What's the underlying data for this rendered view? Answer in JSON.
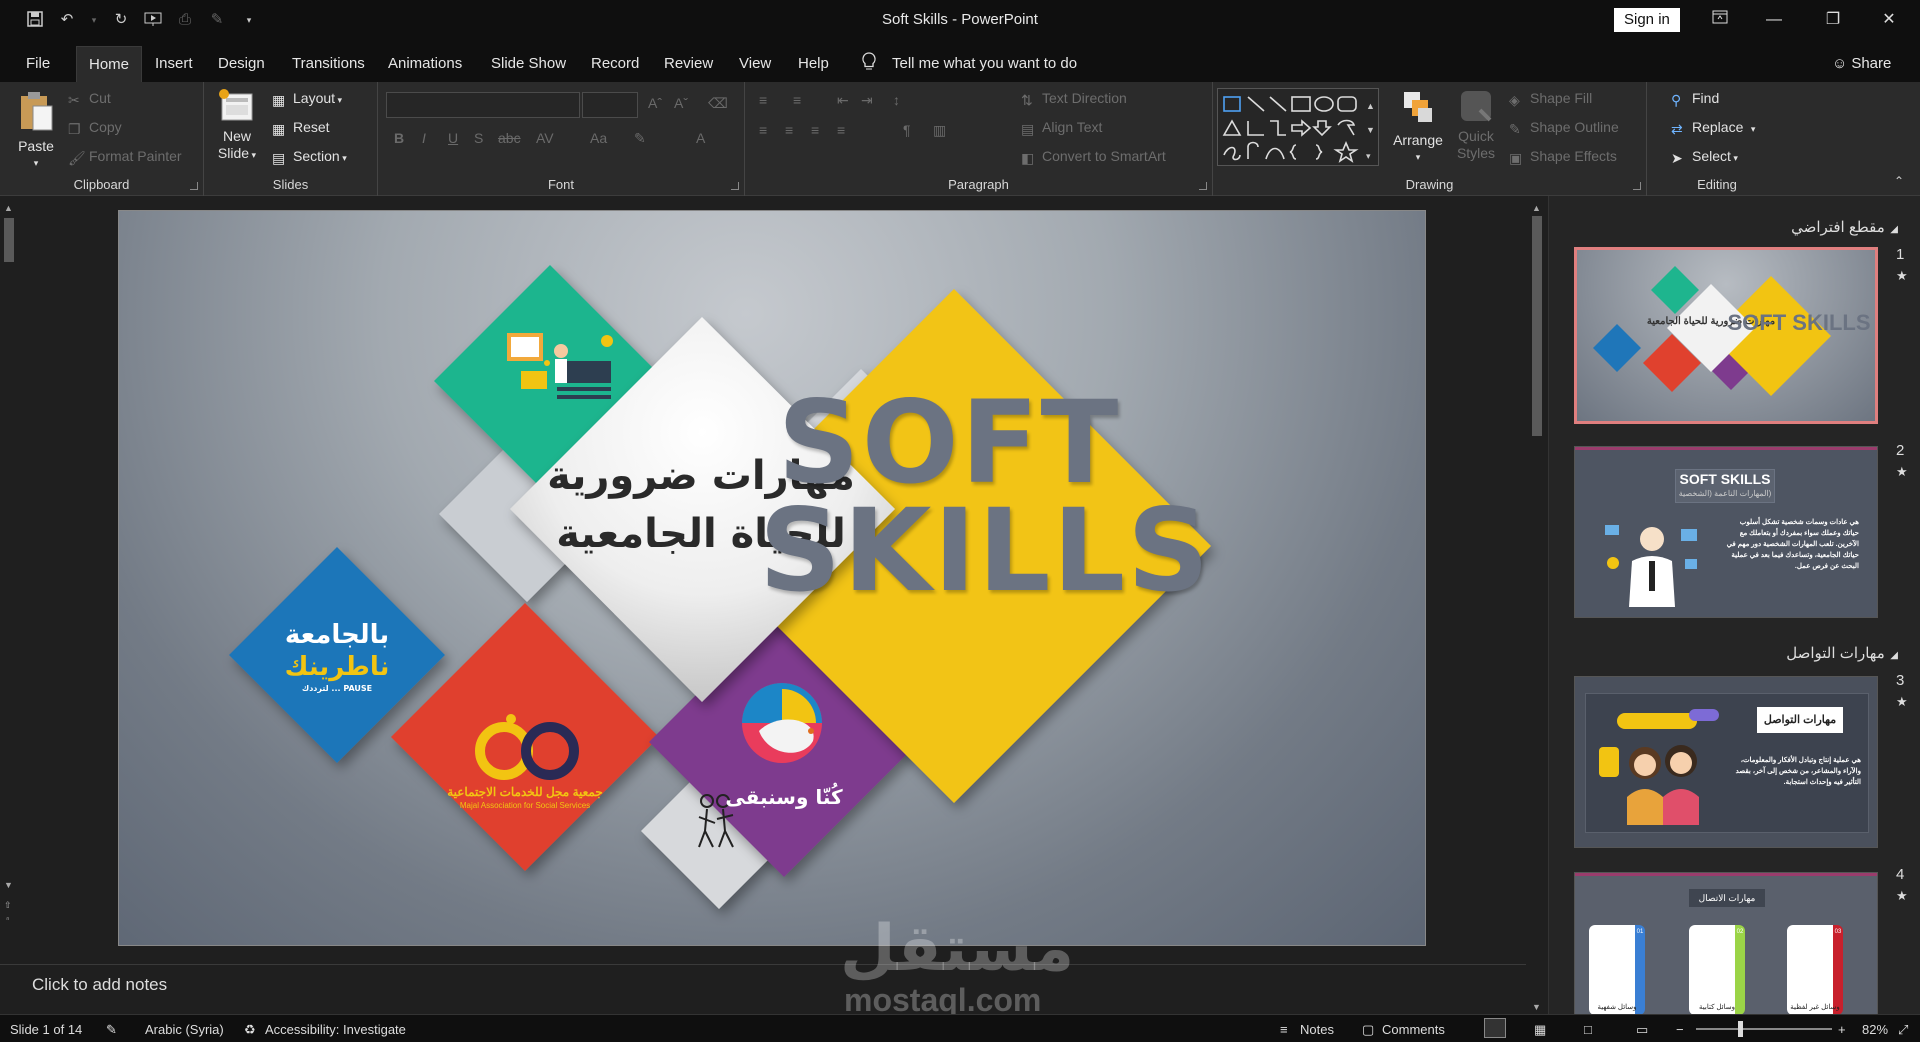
{
  "app": {
    "title": "Soft Skills  -  PowerPoint",
    "sign_in": "Sign in",
    "share": "Share",
    "tell_me": "Tell me what you want to do"
  },
  "tabs": [
    "File",
    "Home",
    "Insert",
    "Design",
    "Transitions",
    "Animations",
    "Slide Show",
    "Record",
    "Review",
    "View",
    "Help"
  ],
  "ribbon": {
    "clipboard": {
      "label": "Clipboard",
      "paste": "Paste",
      "cut": "Cut",
      "copy": "Copy",
      "format_painter": "Format Painter"
    },
    "slides": {
      "label": "Slides",
      "new_slide_1": "New",
      "new_slide_2": "Slide",
      "layout": "Layout",
      "reset": "Reset",
      "section": "Section"
    },
    "font": {
      "label": "Font"
    },
    "paragraph": {
      "label": "Paragraph",
      "text_direction": "Text Direction",
      "align_text": "Align Text",
      "convert": "Convert to SmartArt"
    },
    "drawing": {
      "label": "Drawing",
      "arrange": "Arrange",
      "quick_styles_1": "Quick",
      "quick_styles_2": "Styles",
      "shape_fill": "Shape Fill",
      "shape_outline": "Shape Outline",
      "shape_effects": "Shape Effects"
    },
    "editing": {
      "label": "Editing",
      "find": "Find",
      "replace": "Replace",
      "select": "Select"
    }
  },
  "slide": {
    "arabic_line1": "مهارات ضرورية",
    "arabic_line2": "للحياة الجامعية",
    "soft": "SOFT",
    "skills": "SKILLS",
    "logo_blue_1": "بالجامعة",
    "logo_blue_2": "ناطرينك",
    "logo_blue_pause": "PAUSE ... لترددك",
    "logo_red_ar": "جمعية مجل للخدمات الاجتماعية",
    "logo_red_en": "Majal Association for Social Services",
    "logo_purple": "كُنّا وسنبقى"
  },
  "notes_placeholder": "Click to add notes",
  "panel": {
    "section1": "مقطع افتراضي",
    "section2": "مهارات التواصل",
    "thumbs": [
      {
        "num": "1",
        "title": "SOFT SKILLS",
        "sub": "مهارات ضرورية للحياة الجامعية"
      },
      {
        "num": "2",
        "title": "SOFT SKILLS",
        "sub": "(المهارات الناعمة (الشخصية",
        "body": "هي عادات وسمات شخصية تشكل أسلوب حياتك وعملك سواء بمفردك أو بتعاملك مع الآخرين. تلعب المهارات الشخصية دور مهم في حياتك الجامعية، وتساعدك فيما بعد في عملية البحث عن فرص عمل."
      },
      {
        "num": "3",
        "title": "مهارات التواصل",
        "body": "هي عملية إنتاج وتبادل الأفكار والمعلومات، والآراء والمشاعر، من شخص إلى آخر، بقصد التأثير فيه وإحداث استجابة."
      },
      {
        "num": "4",
        "title": "مهارات الاتصال",
        "items": [
          "وسائل شفهية",
          "وسائل كتابية",
          "وسائل غير لفظية"
        ],
        "nums": [
          "01",
          "02",
          "03"
        ]
      }
    ]
  },
  "status": {
    "slide_of": "Slide 1 of 14",
    "language": "Arabic (Syria)",
    "accessibility": "Accessibility: Investigate",
    "notes": "Notes",
    "comments": "Comments",
    "zoom": "82%"
  },
  "watermark": {
    "ar": "مستقل",
    "en": "mostaql.com"
  },
  "colors": {
    "teal": "#1eb58e",
    "yellow": "#f2c412",
    "blue": "#1f76b9",
    "red": "#e0412e",
    "purple": "#7e3b8e",
    "accent_selected": "#e07f7f"
  }
}
